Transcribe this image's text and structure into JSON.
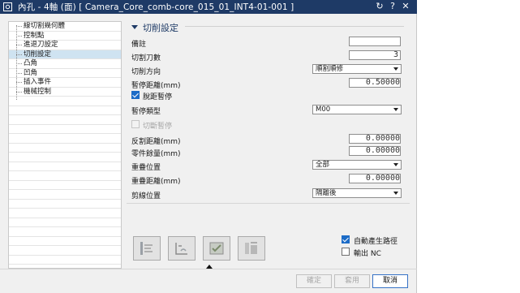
{
  "titlebar": {
    "title": "內孔 - 4軸 (面) [ Camera_Core_comb-core_015_01_INT4-01-001 ]",
    "icons": {
      "app": "window-icon",
      "reset": "reset-icon",
      "help": "help-icon",
      "close": "close-icon"
    }
  },
  "tree": {
    "items": [
      {
        "label": "線切割幾何體"
      },
      {
        "label": "控制點"
      },
      {
        "label": "進退刀設定"
      },
      {
        "label": "切削設定",
        "selected": true
      },
      {
        "label": "凸角"
      },
      {
        "label": "凹角"
      },
      {
        "label": "插入事件"
      },
      {
        "label": "機械控制"
      }
    ]
  },
  "section": {
    "title": "切削設定",
    "fields": {
      "remark": {
        "label": "備註",
        "value": ""
      },
      "cut_count": {
        "label": "切割刀數",
        "value": "3"
      },
      "cut_direction": {
        "label": "切削方向",
        "value": "順割順修"
      },
      "pause_distance": {
        "label": "暫停距離(mm)",
        "value": "0.50000"
      },
      "deviation_pause": {
        "label": "脫距暫停",
        "checked": true
      },
      "pause_type": {
        "label": "暫停類型",
        "value": "M00"
      },
      "cut_stop": {
        "label": "切斷暫停",
        "checked": false,
        "disabled": true
      },
      "reverse_distance": {
        "label": "反割距離(mm)",
        "value": "0.00000"
      },
      "part_margin": {
        "label": "零件餘量(mm)",
        "value": "0.00000"
      },
      "overlap_position": {
        "label": "重疊位置",
        "value": "全部"
      },
      "overlap_distance": {
        "label": "重疊距離(mm)",
        "value": "0.00000"
      },
      "cut_line_position": {
        "label": "剪線位置",
        "value": "隔離後"
      }
    }
  },
  "toolbar_icons": [
    "generate-path-icon",
    "path-preview-icon",
    "path-verify-icon",
    "path-list-icon"
  ],
  "options": {
    "auto_generate_path": {
      "label": "自動產生路徑",
      "checked": true
    },
    "output_nc": {
      "label": "輸出 NC",
      "checked": false
    }
  },
  "buttons": {
    "ok": "確定",
    "apply": "套用",
    "cancel": "取消"
  },
  "colors": {
    "titlebar": "#1e3a66",
    "accent": "#1c6cc7",
    "tree_selected": "#cfe3f1"
  }
}
